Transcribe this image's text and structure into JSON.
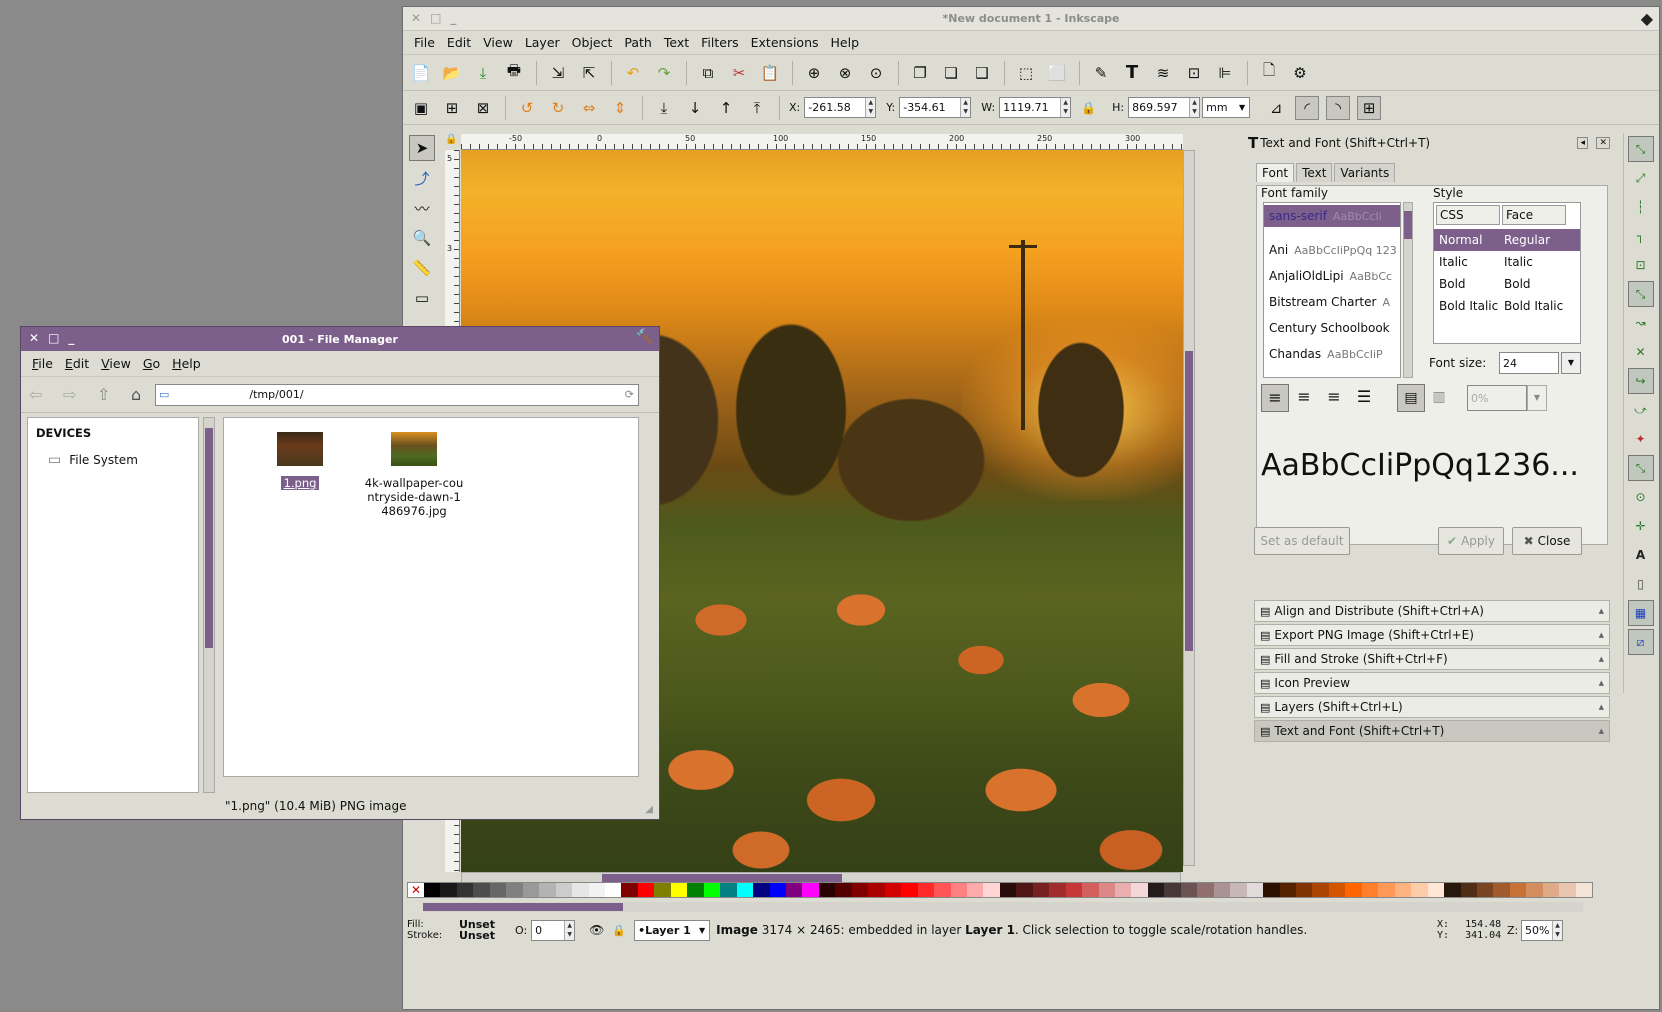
{
  "inkscape": {
    "title": "*New document 1 - Inkscape",
    "menu": [
      "File",
      "Edit",
      "View",
      "Layer",
      "Object",
      "Path",
      "Text",
      "Filters",
      "Extensions",
      "Help"
    ],
    "coords": {
      "x_label": "X:",
      "x": "-261.58",
      "y_label": "Y:",
      "y": "-354.61",
      "w_label": "W:",
      "w": "1119.71",
      "h_label": "H:",
      "h": "869.597",
      "unit": "mm"
    },
    "ruler_ticks": [
      "-50",
      "0",
      "50",
      "100",
      "150",
      "200",
      "250",
      "300"
    ],
    "vruler_ticks": [
      "5",
      "3",
      "0"
    ],
    "status": {
      "fill_label": "Fill:",
      "fill": "Unset",
      "stroke_label": "Stroke:",
      "stroke": "Unset",
      "opacity_label": "O:",
      "opacity": "0",
      "layer": "•Layer 1",
      "message_bold": "Image",
      "message": " 3174 × 2465: embedded in layer ",
      "message_layer": "Layer 1",
      "message_end": ". Click selection to toggle scale/rotation handles.",
      "x_label": "X:",
      "x": "154.48",
      "y_label": "Y:",
      "y": "341.04",
      "z_label": "Z:",
      "zoom": "50%"
    },
    "palette": [
      "#000000",
      "#1a1a1a",
      "#333333",
      "#4d4d4d",
      "#666666",
      "#808080",
      "#999999",
      "#b3b3b3",
      "#cccccc",
      "#e6e6e6",
      "#f2f2f2",
      "#ffffff",
      "#800000",
      "#ff0000",
      "#808000",
      "#ffff00",
      "#008000",
      "#00ff00",
      "#008080",
      "#00ffff",
      "#000080",
      "#0000ff",
      "#800080",
      "#ff00ff",
      "#2b0000",
      "#550000",
      "#800000",
      "#aa0000",
      "#d40000",
      "#ff0000",
      "#ff2a2a",
      "#ff5555",
      "#ff8080",
      "#ffaaaa",
      "#ffd5d5",
      "#280b0b",
      "#501616",
      "#782121",
      "#a02c2c",
      "#c83737",
      "#d35f5f",
      "#de8787",
      "#e9afaf",
      "#f4d7d7",
      "#241c1c",
      "#483737",
      "#6c5353",
      "#916f6f",
      "#ac9393",
      "#c8b7b7",
      "#e3dbdb",
      "#2b1100",
      "#552200",
      "#803300",
      "#aa4400",
      "#d45500",
      "#ff6600",
      "#ff7f2a",
      "#ff9955",
      "#ffb380",
      "#ffccaa",
      "#ffe6d5",
      "#28170b",
      "#502d16",
      "#784421",
      "#a05a2c",
      "#c87137",
      "#d38d5f",
      "#deaa87",
      "#e9c6af",
      "#f4e3d7"
    ]
  },
  "text_font": {
    "header": "Text and Font (Shift+Ctrl+T)",
    "tabs": [
      "Font",
      "Text",
      "Variants"
    ],
    "font_family_label": "Font family",
    "fonts": [
      {
        "name": "sans-serif",
        "preview": "AaBbCcIi"
      },
      {
        "name": "Ani",
        "preview": "AaBbCcIiPpQq 123"
      },
      {
        "name": "AnjaliOldLipi",
        "preview": "AaBbCc"
      },
      {
        "name": "Bitstream Charter",
        "preview": "A"
      },
      {
        "name": "Century Schoolbook",
        "preview": ""
      },
      {
        "name": "Chandas",
        "preview": "AaBbCcIiP"
      }
    ],
    "style_label": "Style",
    "style_headers": [
      "CSS",
      "Face"
    ],
    "styles": [
      [
        "Normal",
        "Regular"
      ],
      [
        "Italic",
        "Italic"
      ],
      [
        "Bold",
        "Bold"
      ],
      [
        "Bold Italic",
        "Bold Italic"
      ]
    ],
    "font_size_label": "Font size:",
    "font_size": "24",
    "spacing": "0%",
    "preview": "AaBbCcIiPpQq1236...",
    "set_default": "Set as default",
    "apply": "Apply",
    "close": "Close"
  },
  "docked_panels": [
    "Align and Distribute (Shift+Ctrl+A)",
    "Export PNG Image (Shift+Ctrl+E)",
    "Fill and Stroke (Shift+Ctrl+F)",
    "Icon Preview",
    "Layers (Shift+Ctrl+L)",
    "Text and Font (Shift+Ctrl+T)"
  ],
  "file_manager": {
    "title": "001 - File Manager",
    "menu": [
      {
        "pre": "",
        "u": "F",
        "post": "ile"
      },
      {
        "pre": "",
        "u": "E",
        "post": "dit"
      },
      {
        "pre": "",
        "u": "V",
        "post": "iew"
      },
      {
        "pre": "",
        "u": "G",
        "post": "o"
      },
      {
        "pre": "",
        "u": "H",
        "post": "elp"
      }
    ],
    "path": "/tmp/001/",
    "devices_label": "DEVICES",
    "device": "File System",
    "files": [
      {
        "name": "1.png"
      },
      {
        "name": "4k-wallpaper-countryside-dawn-1486976.jpg"
      }
    ],
    "status": "\"1.png\" (10.4 MiB) PNG image"
  }
}
